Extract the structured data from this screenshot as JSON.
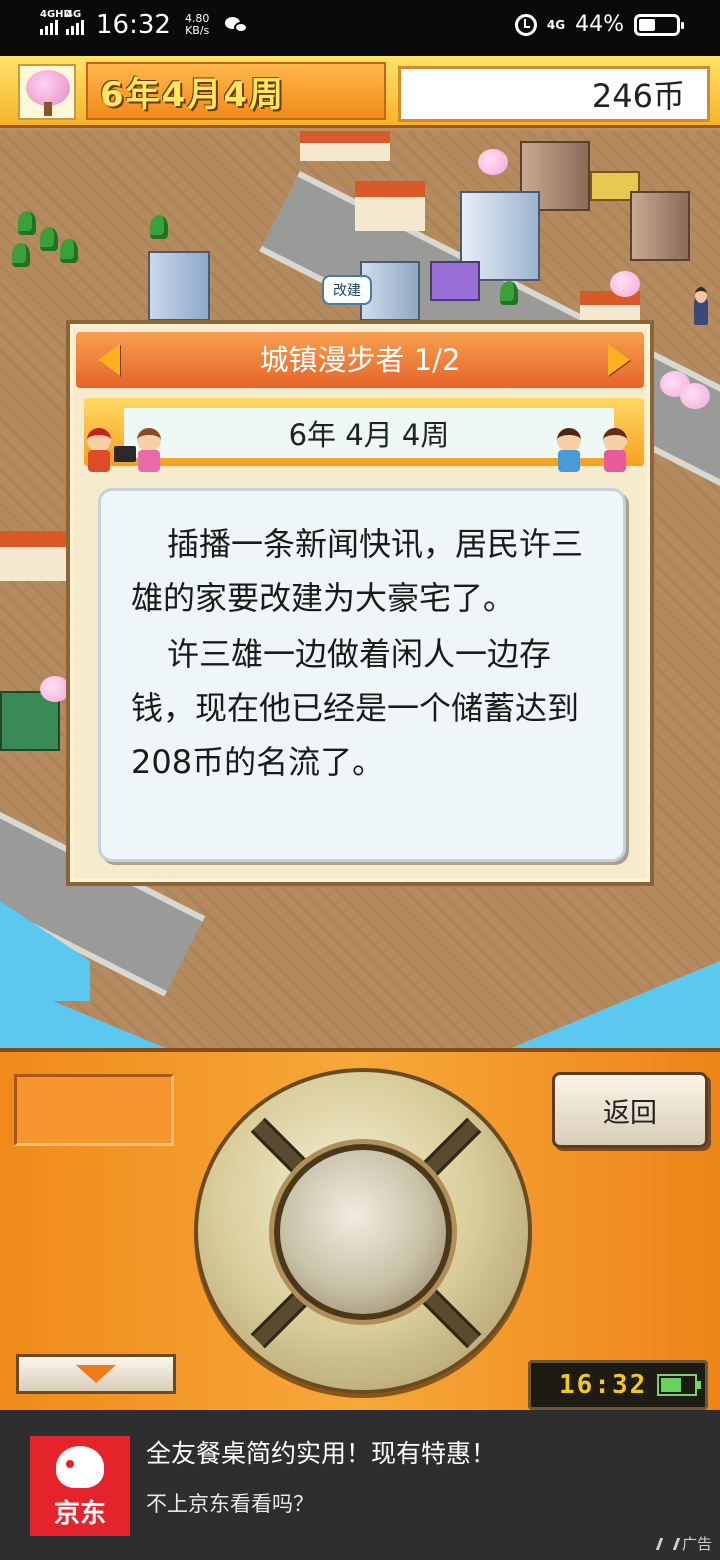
{
  "status_bar": {
    "sim1_label": "4GHD",
    "sim2_label": "4G",
    "time": "16:32",
    "net_speed_value": "4.80",
    "net_speed_unit": "KB/s",
    "network": "4G",
    "battery_percent": "44%",
    "icons": [
      "signal-icon",
      "wechat-icon",
      "alarm-icon",
      "battery-icon"
    ]
  },
  "top_bar": {
    "date": "6年4月4周",
    "money": "246币",
    "icons": [
      "cherry-tree-icon"
    ]
  },
  "map": {
    "building_bubble": "改建"
  },
  "news_dialog": {
    "title": "城镇漫步者 1/2",
    "date": "6年 4月 4周",
    "paragraphs": [
      "插播一条新闻快讯，居民许三雄的家要改建为大豪宅了。",
      "许三雄一边做着闲人一边存钱，现在他已经是一个储蓄达到208币的名流了。"
    ]
  },
  "console": {
    "back_label": "返回",
    "clock": "16:32"
  },
  "ad": {
    "brand": "京东",
    "title": "全友餐桌简约实用！现有特惠！",
    "subtitle": "不上京东看看吗？",
    "tag": "广告"
  },
  "colors": {
    "console_orange": "#f39a2a",
    "dialog_header": "#e6642a",
    "money_bg": "#ffffff",
    "ad_bg": "#2e2e2e",
    "jd_red": "#e4232a"
  }
}
